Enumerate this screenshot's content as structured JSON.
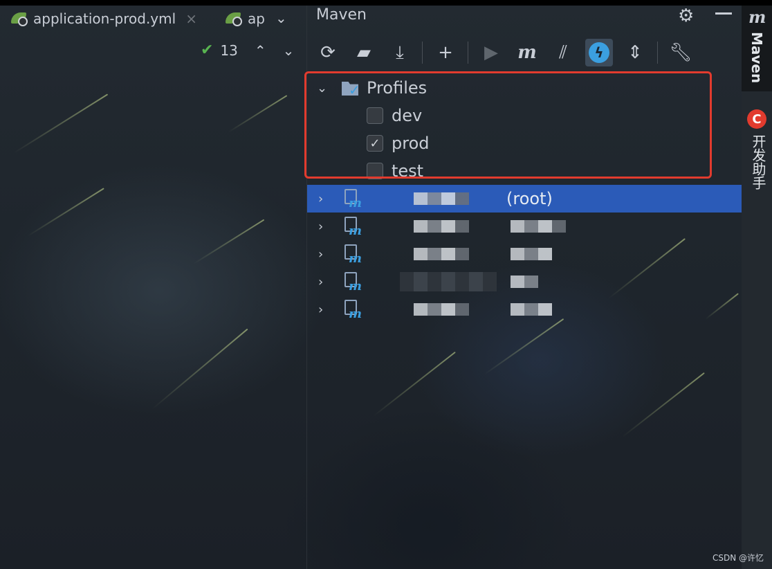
{
  "editor": {
    "tabs": [
      {
        "label": "application-prod.yml",
        "icon": "spring-boot-icon"
      },
      {
        "label": "ap",
        "icon": "spring-boot-icon"
      }
    ],
    "close_glyph": "×",
    "more_glyph": "⌄",
    "inspections": {
      "count": "13"
    }
  },
  "maven": {
    "title": "Maven",
    "toolbar": [
      "reload-all-projects",
      "generate-sources",
      "download-sources",
      "add-maven-project",
      "run-maven-build",
      "execute-maven-goal",
      "toggle-offline-mode",
      "toggle-skip-tests",
      "collapse-all",
      "build-tool-settings"
    ],
    "profiles": {
      "label": "Profiles",
      "items": [
        {
          "name": "dev",
          "checked": false
        },
        {
          "name": "prod",
          "checked": true
        },
        {
          "name": "test",
          "checked": false
        }
      ]
    },
    "modules": [
      {
        "label": "(root)",
        "selected": true
      },
      {
        "label": "",
        "selected": false
      },
      {
        "label": "",
        "selected": false
      },
      {
        "label": "",
        "selected": false
      },
      {
        "label": "",
        "selected": false
      }
    ]
  },
  "right_strip": {
    "maven_label": "Maven",
    "helper_label": "开发助手",
    "helper_badge": "C"
  },
  "watermark": "CSDN @许忆",
  "colors": {
    "selection": "#2b5bb8",
    "highlight_border": "#e23b2e",
    "accent_blue": "#3b9fe0",
    "check_green": "#58b350"
  }
}
